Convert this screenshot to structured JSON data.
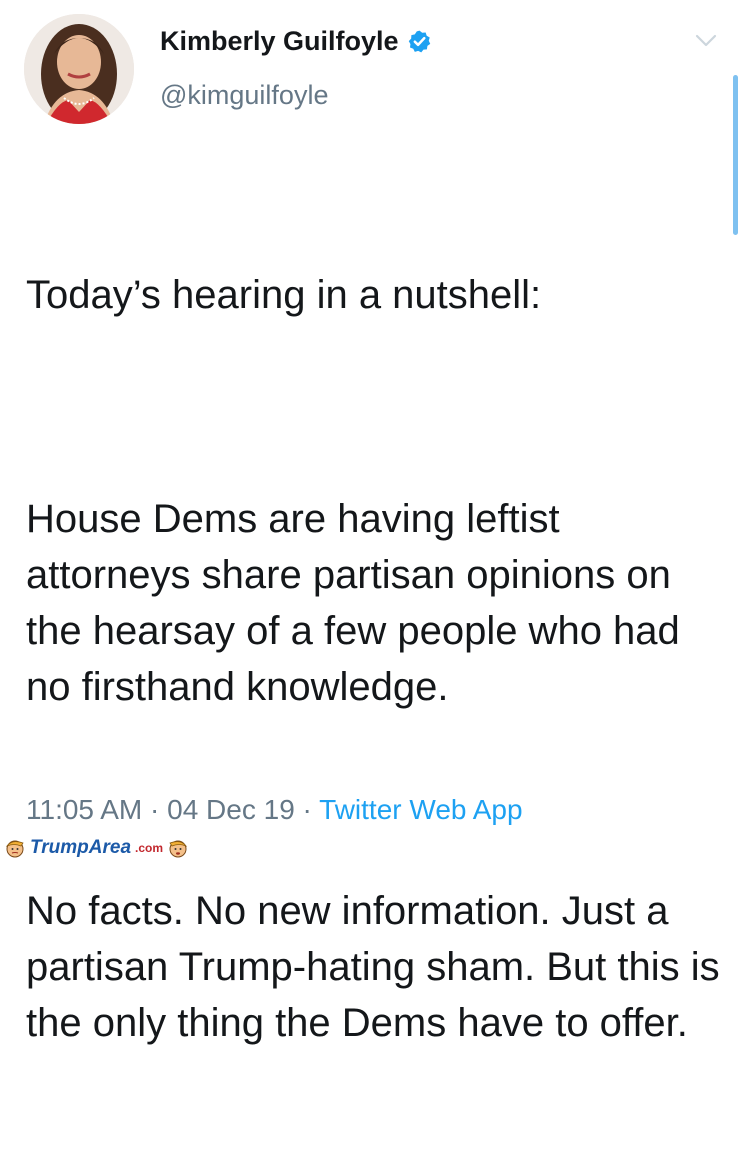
{
  "tweet": {
    "author": {
      "name": "Kimberly Guilfoyle",
      "handle": "@kimguilfoyle",
      "verified": true
    },
    "paragraphs": [
      "Today’s hearing in a nutshell:",
      "House Dems are having leftist attorneys share partisan opinions on the hearsay of a few people who had no firsthand knowledge.",
      "No facts. No new information. Just a partisan Trump-hating sham. But this is the only thing the Dems have to offer."
    ],
    "time": "11:05 AM",
    "date": "04 Dec 19",
    "source": "Twitter Web App",
    "separator": "·"
  },
  "watermark": {
    "text": "TrumpArea",
    "suffix": ".com"
  },
  "colors": {
    "text": "#14171a",
    "secondary": "#657786",
    "accent": "#1da1f2"
  },
  "icons": {
    "verified": "verified-badge-icon",
    "menu": "chevron-down-icon"
  }
}
